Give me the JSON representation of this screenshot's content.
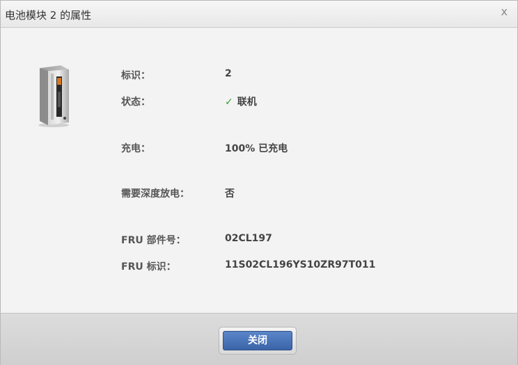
{
  "dialog": {
    "title": "电池模块 2 的属性",
    "close_glyph": "x"
  },
  "properties": [
    {
      "label": "标识：",
      "value": "2"
    },
    {
      "label": "状态：",
      "value": "联机",
      "icon": "checkmark-icon",
      "icon_glyph": "✓",
      "icon_color": "#2e9d2e"
    },
    {
      "label": "充电：",
      "value": "100% 已充电"
    },
    {
      "label": "需要深度放电：",
      "value": "否"
    },
    {
      "label": "FRU 部件号：",
      "value": "02CL197"
    },
    {
      "label": "FRU 标识：",
      "value": "11S02CL196YS10ZR97T011"
    }
  ],
  "footer": {
    "close_button_label": "关闭",
    "button_color": "#3b64a8"
  },
  "device_image": {
    "icon": "battery-module-icon"
  }
}
